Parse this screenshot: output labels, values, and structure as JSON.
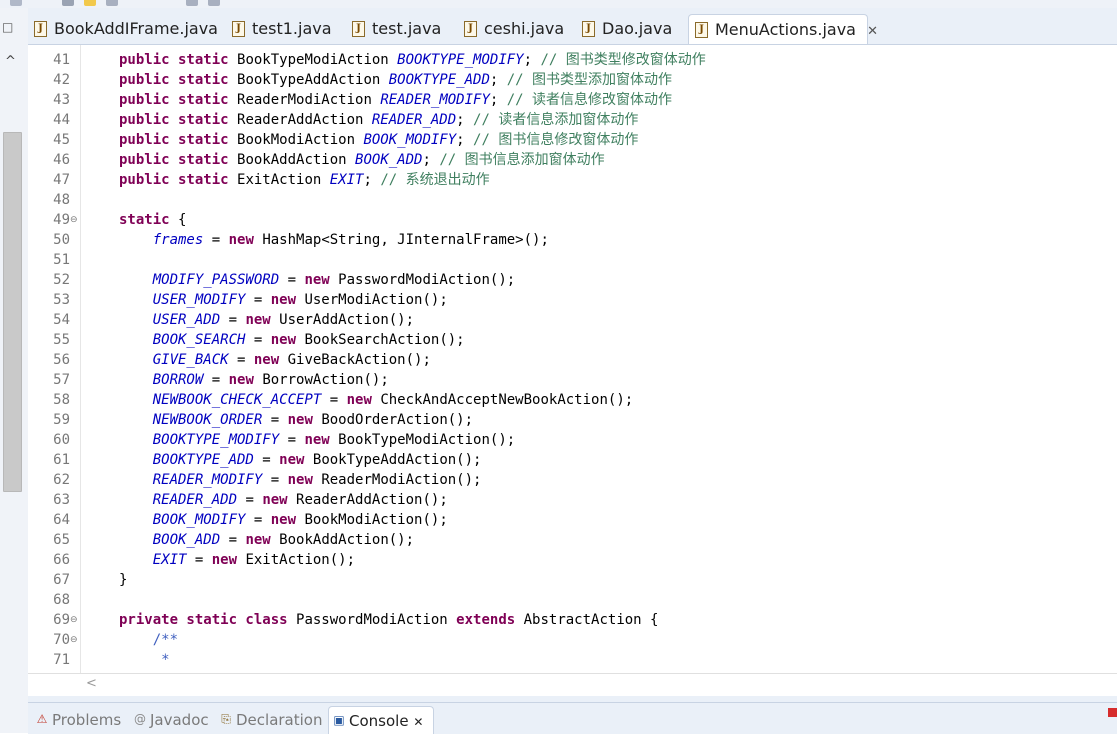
{
  "editor_tabs": [
    {
      "label": "BookAddIFrame.java",
      "active": false
    },
    {
      "label": "test1.java",
      "active": false
    },
    {
      "label": "test.java",
      "active": false
    },
    {
      "label": "ceshi.java",
      "active": false
    },
    {
      "label": "Dao.java",
      "active": false
    },
    {
      "label": "MenuActions.java",
      "active": true
    }
  ],
  "close_glyph": "✕",
  "line_numbers": [
    "41",
    "42",
    "43",
    "44",
    "45",
    "46",
    "47",
    "48",
    "49",
    "50",
    "51",
    "52",
    "53",
    "54",
    "55",
    "56",
    "57",
    "58",
    "59",
    "60",
    "61",
    "62",
    "63",
    "64",
    "65",
    "66",
    "67",
    "68",
    "69",
    "70",
    "71"
  ],
  "fold_markers": {
    "49": "⊖",
    "69": "⊖",
    "70": "⊖"
  },
  "code_lines": [
    [
      [
        "kw",
        "public static "
      ],
      [
        "",
        "BookTypeModiAction "
      ],
      [
        "fld",
        "BOOKTYPE_MODIFY"
      ],
      [
        "",
        "; "
      ],
      [
        "cmt",
        "// 图书类型修改窗体动作"
      ]
    ],
    [
      [
        "kw",
        "public static "
      ],
      [
        "",
        "BookTypeAddAction "
      ],
      [
        "fld",
        "BOOKTYPE_ADD"
      ],
      [
        "",
        "; "
      ],
      [
        "cmt",
        "// 图书类型添加窗体动作"
      ]
    ],
    [
      [
        "kw",
        "public static "
      ],
      [
        "",
        "ReaderModiAction "
      ],
      [
        "fld",
        "READER_MODIFY"
      ],
      [
        "",
        "; "
      ],
      [
        "cmt",
        "// 读者信息修改窗体动作"
      ]
    ],
    [
      [
        "kw",
        "public static "
      ],
      [
        "",
        "ReaderAddAction "
      ],
      [
        "fld",
        "READER_ADD"
      ],
      [
        "",
        "; "
      ],
      [
        "cmt",
        "// 读者信息添加窗体动作"
      ]
    ],
    [
      [
        "kw",
        "public static "
      ],
      [
        "",
        "BookModiAction "
      ],
      [
        "fld",
        "BOOK_MODIFY"
      ],
      [
        "",
        "; "
      ],
      [
        "cmt",
        "// 图书信息修改窗体动作"
      ]
    ],
    [
      [
        "kw",
        "public static "
      ],
      [
        "",
        "BookAddAction "
      ],
      [
        "fld",
        "BOOK_ADD"
      ],
      [
        "",
        "; "
      ],
      [
        "cmt",
        "// 图书信息添加窗体动作"
      ]
    ],
    [
      [
        "kw",
        "public static "
      ],
      [
        "",
        "ExitAction "
      ],
      [
        "fld",
        "EXIT"
      ],
      [
        "",
        "; "
      ],
      [
        "cmt",
        "// 系统退出动作"
      ]
    ],
    [],
    [
      [
        "kw",
        "static "
      ],
      [
        "",
        "{"
      ]
    ],
    [
      [
        "",
        "    "
      ],
      [
        "fld",
        "frames"
      ],
      [
        "",
        " = "
      ],
      [
        "kw",
        "new "
      ],
      [
        "",
        "HashMap<String, JInternalFrame>();"
      ]
    ],
    [],
    [
      [
        "",
        "    "
      ],
      [
        "fld",
        "MODIFY_PASSWORD"
      ],
      [
        "",
        " = "
      ],
      [
        "kw",
        "new "
      ],
      [
        "",
        "PasswordModiAction();"
      ]
    ],
    [
      [
        "",
        "    "
      ],
      [
        "fld",
        "USER_MODIFY"
      ],
      [
        "",
        " = "
      ],
      [
        "kw",
        "new "
      ],
      [
        "",
        "UserModiAction();"
      ]
    ],
    [
      [
        "",
        "    "
      ],
      [
        "fld",
        "USER_ADD"
      ],
      [
        "",
        " = "
      ],
      [
        "kw",
        "new "
      ],
      [
        "",
        "UserAddAction();"
      ]
    ],
    [
      [
        "",
        "    "
      ],
      [
        "fld",
        "BOOK_SEARCH"
      ],
      [
        "",
        " = "
      ],
      [
        "kw",
        "new "
      ],
      [
        "",
        "BookSearchAction();"
      ]
    ],
    [
      [
        "",
        "    "
      ],
      [
        "fld",
        "GIVE_BACK"
      ],
      [
        "",
        " = "
      ],
      [
        "kw",
        "new "
      ],
      [
        "",
        "GiveBackAction();"
      ]
    ],
    [
      [
        "",
        "    "
      ],
      [
        "fld",
        "BORROW"
      ],
      [
        "",
        " = "
      ],
      [
        "kw",
        "new "
      ],
      [
        "",
        "BorrowAction();"
      ]
    ],
    [
      [
        "",
        "    "
      ],
      [
        "fld",
        "NEWBOOK_CHECK_ACCEPT"
      ],
      [
        "",
        " = "
      ],
      [
        "kw",
        "new "
      ],
      [
        "",
        "CheckAndAcceptNewBookAction();"
      ]
    ],
    [
      [
        "",
        "    "
      ],
      [
        "fld",
        "NEWBOOK_ORDER"
      ],
      [
        "",
        " = "
      ],
      [
        "kw",
        "new "
      ],
      [
        "",
        "BoodOrderAction();"
      ]
    ],
    [
      [
        "",
        "    "
      ],
      [
        "fld",
        "BOOKTYPE_MODIFY"
      ],
      [
        "",
        " = "
      ],
      [
        "kw",
        "new "
      ],
      [
        "",
        "BookTypeModiAction();"
      ]
    ],
    [
      [
        "",
        "    "
      ],
      [
        "fld",
        "BOOKTYPE_ADD"
      ],
      [
        "",
        " = "
      ],
      [
        "kw",
        "new "
      ],
      [
        "",
        "BookTypeAddAction();"
      ]
    ],
    [
      [
        "",
        "    "
      ],
      [
        "fld",
        "READER_MODIFY"
      ],
      [
        "",
        " = "
      ],
      [
        "kw",
        "new "
      ],
      [
        "",
        "ReaderModiAction();"
      ]
    ],
    [
      [
        "",
        "    "
      ],
      [
        "fld",
        "READER_ADD"
      ],
      [
        "",
        " = "
      ],
      [
        "kw",
        "new "
      ],
      [
        "",
        "ReaderAddAction();"
      ]
    ],
    [
      [
        "",
        "    "
      ],
      [
        "fld",
        "BOOK_MODIFY"
      ],
      [
        "",
        " = "
      ],
      [
        "kw",
        "new "
      ],
      [
        "",
        "BookModiAction();"
      ]
    ],
    [
      [
        "",
        "    "
      ],
      [
        "fld",
        "BOOK_ADD"
      ],
      [
        "",
        " = "
      ],
      [
        "kw",
        "new "
      ],
      [
        "",
        "BookAddAction();"
      ]
    ],
    [
      [
        "",
        "    "
      ],
      [
        "fld",
        "EXIT"
      ],
      [
        "",
        " = "
      ],
      [
        "kw",
        "new "
      ],
      [
        "",
        "ExitAction();"
      ]
    ],
    [
      [
        "",
        "}"
      ]
    ],
    [],
    [
      [
        "kw",
        "private static class "
      ],
      [
        "",
        "PasswordModiAction "
      ],
      [
        "kw",
        "extends "
      ],
      [
        "",
        "AbstractAction {"
      ]
    ],
    [
      [
        "",
        "    "
      ],
      [
        "jdoc",
        "/**"
      ]
    ],
    [
      [
        "",
        "     "
      ],
      [
        "jdoc",
        "*"
      ]
    ]
  ],
  "view_tabs": [
    {
      "label": "Problems",
      "icon": "problems-icon",
      "glyph": "⚠",
      "active": false
    },
    {
      "label": "Javadoc",
      "icon": "javadoc-icon",
      "glyph": "@",
      "active": false
    },
    {
      "label": "Declaration",
      "icon": "declaration-icon",
      "glyph": "⎘",
      "active": false
    },
    {
      "label": "Console",
      "icon": "console-icon",
      "glyph": "▣",
      "active": true
    }
  ],
  "colors": {
    "keyword": "#7f0055",
    "field": "#0000c0",
    "comment": "#3f7f5f",
    "javadoc": "#3f5fbf",
    "line_number": "#787878"
  }
}
